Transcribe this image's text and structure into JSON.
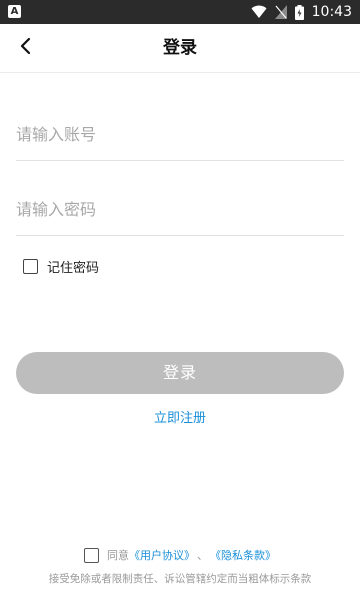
{
  "status_bar": {
    "left_icon": "A",
    "time": "10:43",
    "icons": [
      "wifi-icon",
      "signal-icon",
      "battery-icon"
    ]
  },
  "header": {
    "back_icon": "chevron-left-icon",
    "title": "登录"
  },
  "form": {
    "account_placeholder": "请输入账号",
    "account_value": "",
    "password_placeholder": "请输入密码",
    "password_value": "",
    "remember_label": "记住密码",
    "remember_checked": false
  },
  "actions": {
    "login_label": "登录",
    "register_label": "立即注册"
  },
  "agreement": {
    "checked": false,
    "prefix": "同意",
    "user_agreement": "《用户协议》",
    "separator": "、",
    "privacy_policy": "《隐私条款》",
    "note": "接受免除或者限制责任、诉讼管辖约定而当粗体标示条款"
  },
  "colors": {
    "accent": "#1a8fd8",
    "button_disabled": "#bdbdbd",
    "status_bar": "#2b2b2b"
  }
}
